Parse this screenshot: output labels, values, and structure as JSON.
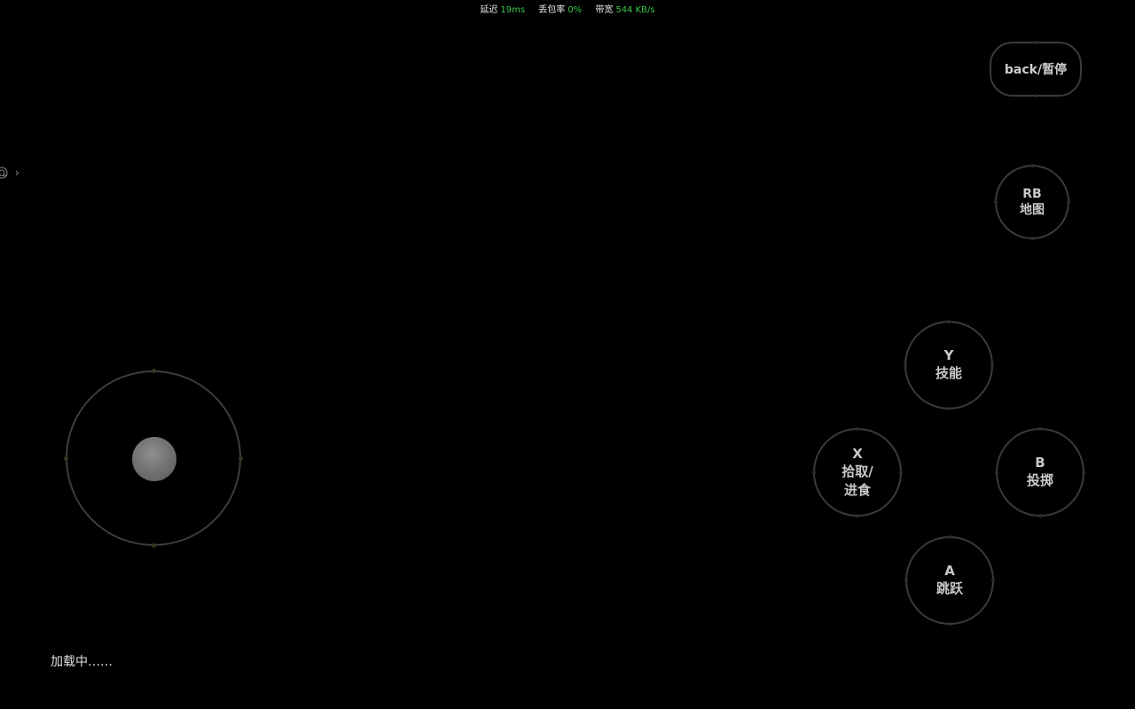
{
  "stats": {
    "latency_label": "延迟",
    "latency_value": "19ms",
    "packet_loss_label": "丢包率",
    "packet_loss_value": "0%",
    "bandwidth_label": "带宽",
    "bandwidth_value": "544 KB/s",
    "value_color": "#37c84a"
  },
  "float_menu": {
    "icon": "controller-icon",
    "arrow": "›"
  },
  "controls": {
    "back": {
      "label": "back/暂停"
    },
    "rb": {
      "key": "RB",
      "action": "地图"
    },
    "y": {
      "key": "Y",
      "action": "技能"
    },
    "x": {
      "key": "X",
      "action_line1": "拾取/",
      "action_line2": "进食"
    },
    "b": {
      "key": "B",
      "action": "投掷"
    },
    "a": {
      "key": "A",
      "action": "跳跃"
    }
  },
  "joystick": {
    "icon": "joystick-knob"
  },
  "status": {
    "loading": "加载中……"
  }
}
